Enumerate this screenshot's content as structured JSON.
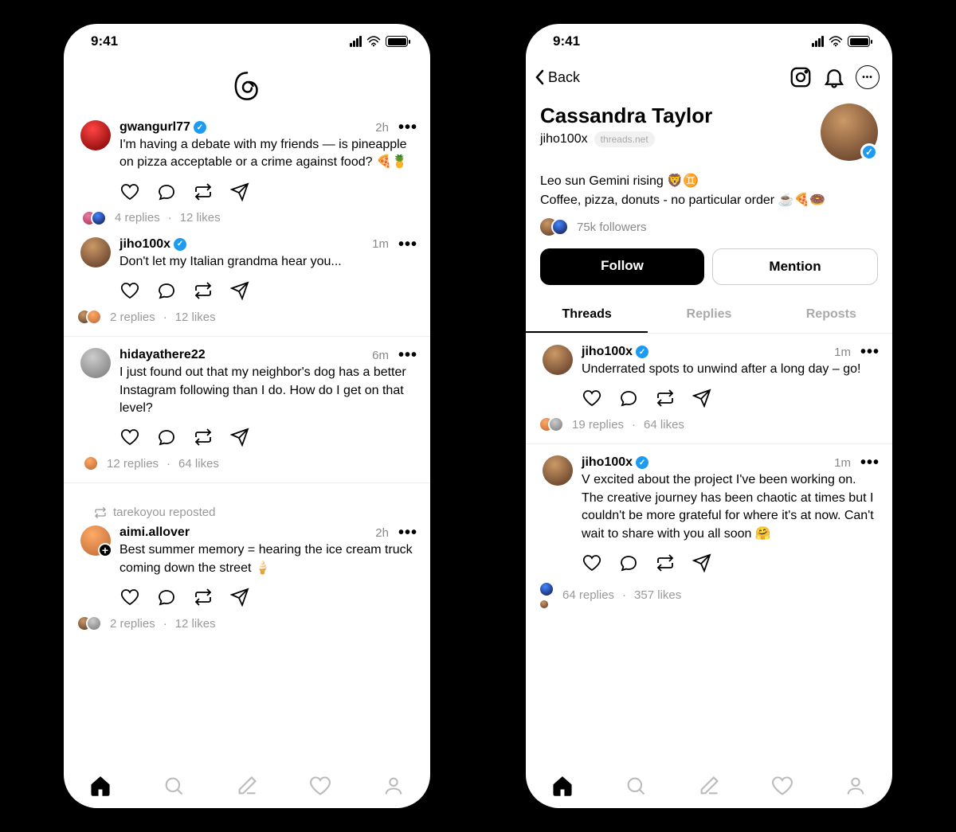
{
  "status": {
    "time": "9:41"
  },
  "feed": {
    "posts": [
      {
        "user": "gwangurl77",
        "verified": true,
        "time": "2h",
        "body": "I'm having a debate with my friends — is pineapple on pizza acceptable or a crime against food? 🍕🍍",
        "replies": "4 replies",
        "likes": "12 likes",
        "avatar_tint": "av-red",
        "is_reply_parent": true
      },
      {
        "user": "jiho100x",
        "verified": true,
        "time": "1m",
        "body": "Don't let my Italian grandma hear you...",
        "replies": "2 replies",
        "likes": "12 likes",
        "avatar_tint": "av-mar",
        "is_reply_child": true
      },
      {
        "user": "hidayathere22",
        "verified": false,
        "time": "6m",
        "body": "I just found out that my neighbor's dog has a better Instagram following than I do. How do I get on that level?",
        "replies": "12 replies",
        "likes": "64 likes",
        "avatar_tint": "av-gry",
        "separator": true
      },
      {
        "repost_by": "tarekoyou reposted",
        "user": "aimi.allover",
        "verified": false,
        "time": "2h",
        "body": "Best summer memory = hearing the ice cream truck coming down the street 🍦",
        "replies": "2 replies",
        "likes": "12 likes",
        "avatar_tint": "av-org",
        "has_plus": true,
        "separator": true
      }
    ]
  },
  "profile": {
    "back_label": "Back",
    "display_name": "Cassandra Taylor",
    "handle": "jiho100x",
    "domain": "threads.net",
    "bio_line1": "Leo sun Gemini rising 🦁♊",
    "bio_line2": "Coffee, pizza, donuts - no particular order ☕🍕🍩",
    "followers": "75k followers",
    "follow_btn": "Follow",
    "mention_btn": "Mention",
    "tabs": {
      "threads": "Threads",
      "replies": "Replies",
      "reposts": "Reposts"
    },
    "posts": [
      {
        "user": "jiho100x",
        "verified": true,
        "time": "1m",
        "body": "Underrated spots to unwind after a long day – go!",
        "replies": "19 replies",
        "likes": "64 likes",
        "avatar_tint": "av-mar"
      },
      {
        "user": "jiho100x",
        "verified": true,
        "time": "1m",
        "body": "V excited about the project I've been working on. The creative journey has been chaotic at times but I couldn't be more grateful for where it's at now. Can't wait to share with you all soon 🤗",
        "replies": "64 replies",
        "likes": "357 likes",
        "avatar_tint": "av-mar",
        "separator": true
      }
    ]
  }
}
